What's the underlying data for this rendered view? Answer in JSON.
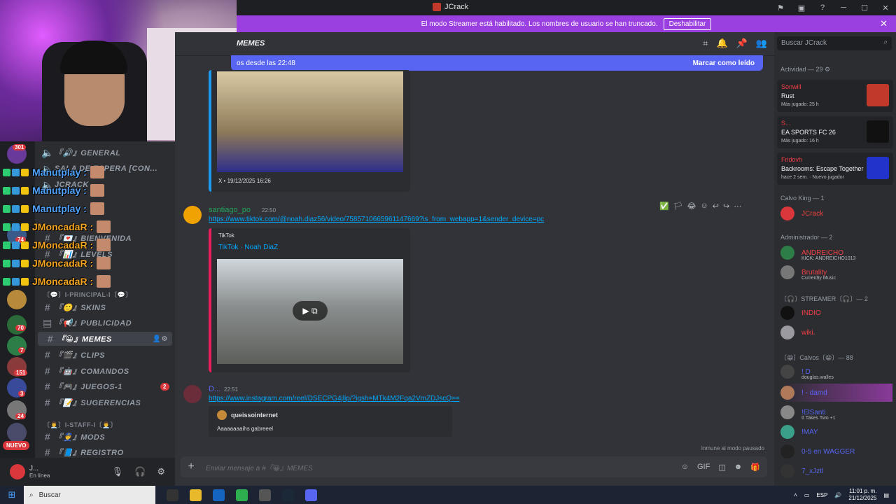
{
  "window": {
    "title": "JCrack",
    "controls": [
      "─",
      "☐",
      "✕"
    ]
  },
  "banner": {
    "text": "El modo Streamer está habilitado. Los nombres de usuario se han truncado.",
    "button": "Deshabilitar"
  },
  "header": {
    "channel": "MEMES"
  },
  "new_messages": {
    "text": "os desde las 22:48",
    "action": "Marcar como leído"
  },
  "messages": [
    {
      "embed_footer": "X • 19/12/2025 16:26"
    },
    {
      "author": "santiago_po",
      "time": "22:50",
      "link": "https://www.tiktok.com/@noah.diaz56/video/7585710665961147669?is_from_webapp=1&sender_device=pc",
      "embed_provider": "TikTok",
      "embed_title": "TikTok · Noah DiaZ"
    },
    {
      "author": "D...",
      "time": "22:51",
      "link": "https://www.instagram.com/reel/DSECPG4jlip/?igsh=MTk4M2Fqa2VmZDJscQ==",
      "quote_author": "queissointernet",
      "quote_text": "Aaaaaaaaihs gabreeel"
    }
  ],
  "composer": {
    "placeholder": "Enviar mensaje a #『😀』MEMES"
  },
  "paused": "Inmune al modo pausado",
  "channels": [
    {
      "name": "『🔊』GENERAL",
      "type": "voice"
    },
    {
      "name": "SALA DE ESPERA [CON...",
      "type": "voice"
    },
    {
      "name": "JCRACK",
      "type": "voice"
    },
    {
      "name": "『💌』BIENVENIDA",
      "type": "text"
    },
    {
      "name": "『📊』LEVELS",
      "type": "text"
    },
    {
      "name": "〔💬〕I-PRINCIPAL-I〔💬〕",
      "type": "category"
    },
    {
      "name": "『🙂』SKINS",
      "type": "text"
    },
    {
      "name": "『📢』PUBLICIDAD",
      "type": "text"
    },
    {
      "name": "『😀』MEMES",
      "type": "text",
      "active": true
    },
    {
      "name": "『🎬』CLIPS",
      "type": "text"
    },
    {
      "name": "『🤖』COMANDOS",
      "type": "text"
    },
    {
      "name": "『🎮』JUEGOS-1",
      "type": "text",
      "badge": "2"
    },
    {
      "name": "『📝』SUGERENCIAS",
      "type": "text"
    },
    {
      "name": "〔👨‍💼〕I-STAFF-I〔👨‍💼〕",
      "type": "category"
    },
    {
      "name": "『👮』MODS",
      "type": "text"
    },
    {
      "name": "『📘』REGISTRO",
      "type": "text"
    }
  ],
  "rail_badges": [
    "301",
    "74",
    "70",
    "7",
    "151",
    "3",
    "24"
  ],
  "rail_new": "NUEVO",
  "overlay": [
    {
      "name": "Manutplay :",
      "color": "#4fa3ff"
    },
    {
      "name": "Manutplay :",
      "color": "#4fa3ff"
    },
    {
      "name": "Manutplay :",
      "color": "#4fa3ff"
    },
    {
      "name": "JMoncadaR :",
      "color": "#f5a623"
    },
    {
      "name": "JMoncadaR :",
      "color": "#f5a623"
    },
    {
      "name": "JMoncadaR :",
      "color": "#f5a623"
    },
    {
      "name": "JMoncadaR :",
      "color": "#f5a623"
    }
  ],
  "user": {
    "name": "J...",
    "status": "En línea"
  },
  "search": {
    "placeholder": "Buscar JCrack"
  },
  "activity": {
    "header": "Actividad — 29 ⚙",
    "items": [
      {
        "user": "Sonwill",
        "game": "Rust",
        "time": "Más jugado: 25 h",
        "art": "#c0392b"
      },
      {
        "user": "S...",
        "game": "EA SPORTS FC 26",
        "time": "Más jugado: 16 h",
        "art": "#111111"
      },
      {
        "user": "Fridovh",
        "game": "Backrooms: Escape Together",
        "time": "hace 2 sem. · Nuevo jugador",
        "art": "#2233cc"
      }
    ]
  },
  "members": [
    {
      "section": "Calvo King — 1"
    },
    {
      "name": "JCrack",
      "color": "#f23f43"
    },
    {
      "section": "Administrador — 2"
    },
    {
      "name": "ANDREICHO",
      "color": "#f23f43",
      "sub": "KICK: ANDREICHO1013"
    },
    {
      "name": "Brutality",
      "color": "#f23f43",
      "sub": "Curren$y Music"
    },
    {
      "section": "〔🎧〕STREAMER〔🎧〕— 2"
    },
    {
      "name": "INDIO",
      "color": "#f23f43"
    },
    {
      "name": "wiki.",
      "color": "#f23f43"
    },
    {
      "section": "〔😀〕Calvos〔😀〕— 88"
    },
    {
      "name": "! D",
      "color": "#5865f2",
      "sub": "douglas.walles"
    },
    {
      "name": "! - damd",
      "color": "#5865f2"
    },
    {
      "name": "!ElSanti",
      "color": "#5865f2",
      "sub": "It Takes Two +1"
    },
    {
      "name": "!MAY",
      "color": "#5865f2"
    },
    {
      "name": "0-5 en WAGGER",
      "color": "#5865f2"
    },
    {
      "name": "7_xJztl",
      "color": "#5865f2"
    }
  ],
  "taskbar": {
    "search": "Buscar",
    "lang": "ESP",
    "time": "11:01 p. m.",
    "date": "21/12/2025"
  }
}
